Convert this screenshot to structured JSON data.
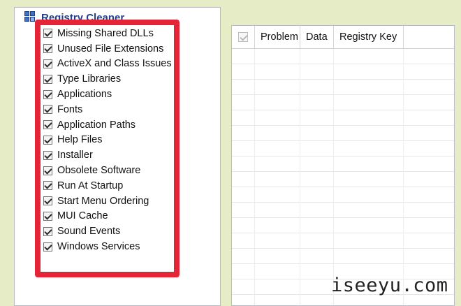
{
  "window": {
    "panel_title": "Registry Cleaner",
    "accent_color": "#1f3f8f",
    "highlight_color": "#e42437"
  },
  "categories": [
    {
      "label": "Missing Shared DLLs",
      "checked": true
    },
    {
      "label": "Unused File Extensions",
      "checked": true
    },
    {
      "label": "ActiveX and Class Issues",
      "checked": true
    },
    {
      "label": "Type Libraries",
      "checked": true
    },
    {
      "label": "Applications",
      "checked": true
    },
    {
      "label": "Fonts",
      "checked": true
    },
    {
      "label": "Application Paths",
      "checked": true
    },
    {
      "label": "Help Files",
      "checked": true
    },
    {
      "label": "Installer",
      "checked": true
    },
    {
      "label": "Obsolete Software",
      "checked": true
    },
    {
      "label": "Run At Startup",
      "checked": true
    },
    {
      "label": "Start Menu Ordering",
      "checked": true
    },
    {
      "label": "MUI Cache",
      "checked": true
    },
    {
      "label": "Sound Events",
      "checked": true
    },
    {
      "label": "Windows Services",
      "checked": true
    }
  ],
  "results_table": {
    "columns": [
      "Problem",
      "Data",
      "Registry Key"
    ],
    "select_all_checked": true,
    "rows": []
  },
  "watermark": "iseeyu.com",
  "icons": {
    "panel_icon": "registry-icon",
    "checkbox": "checkmark-icon"
  }
}
